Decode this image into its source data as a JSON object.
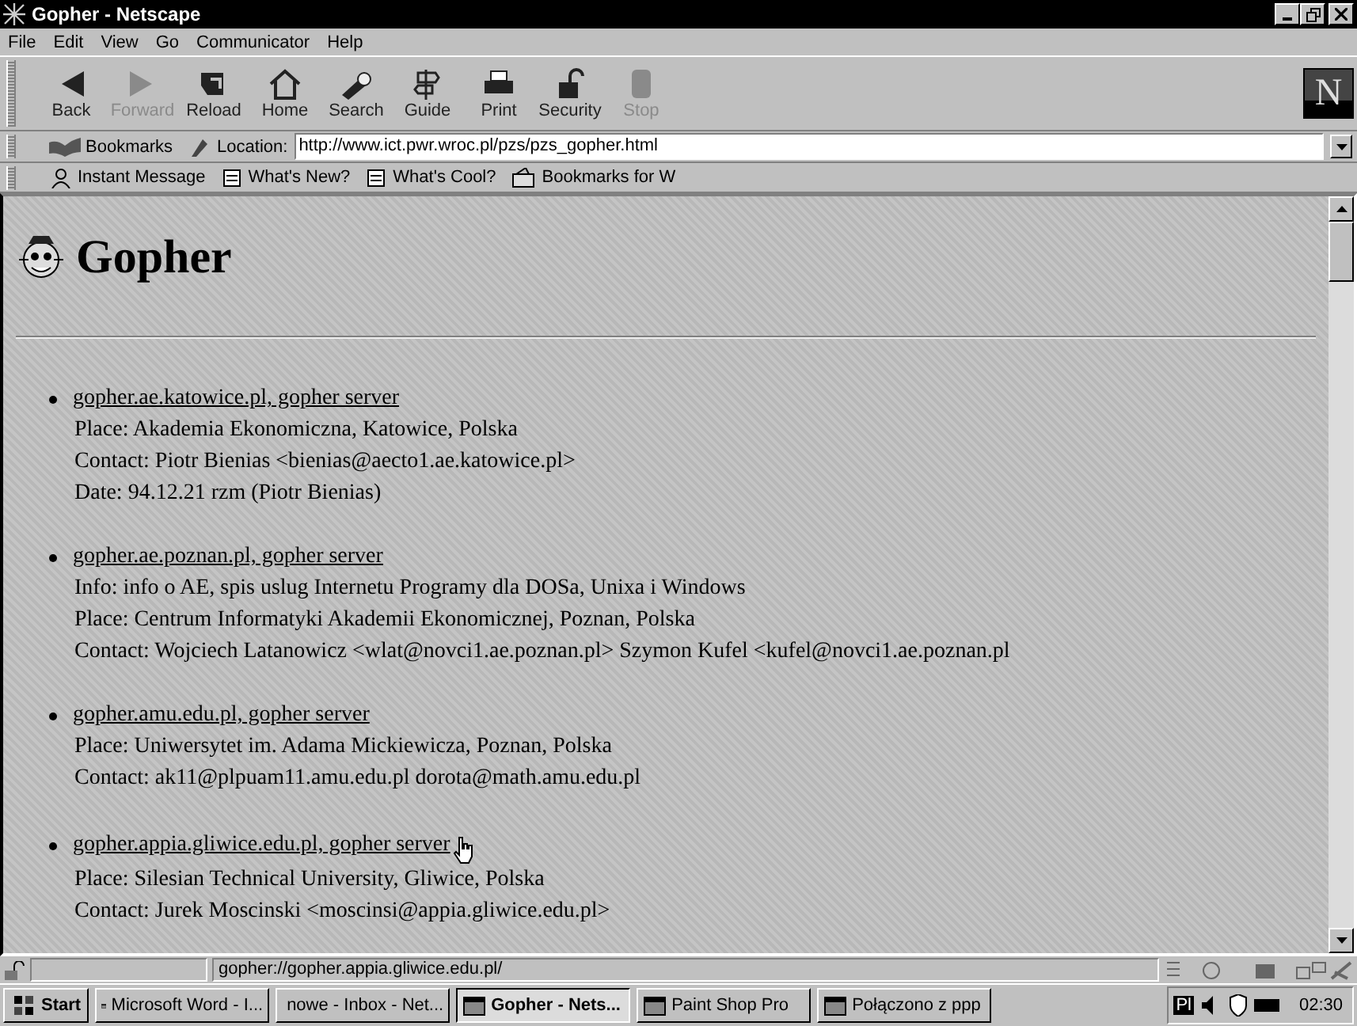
{
  "window": {
    "title": "Gopher - Netscape"
  },
  "menu": [
    "File",
    "Edit",
    "View",
    "Go",
    "Communicator",
    "Help"
  ],
  "toolbar": [
    {
      "label": "Back",
      "kind": "back",
      "disabled": false
    },
    {
      "label": "Forward",
      "kind": "forward",
      "disabled": true
    },
    {
      "label": "Reload",
      "kind": "reload",
      "disabled": false
    },
    {
      "label": "Home",
      "kind": "home",
      "disabled": false
    },
    {
      "label": "Search",
      "kind": "search",
      "disabled": false
    },
    {
      "label": "Guide",
      "kind": "guide",
      "disabled": false
    },
    {
      "label": "Print",
      "kind": "print",
      "disabled": false
    },
    {
      "label": "Security",
      "kind": "security",
      "disabled": false
    },
    {
      "label": "Stop",
      "kind": "stop",
      "disabled": true
    }
  ],
  "logo_letter": "N",
  "location_bar": {
    "bookmarks": "Bookmarks",
    "label": "Location:",
    "url": "http://www.ict.pwr.wroc.pl/pzs/pzs_gopher.html"
  },
  "personal_toolbar": [
    {
      "label": "Instant Message",
      "kind": "person"
    },
    {
      "label": "What's New?",
      "kind": "page"
    },
    {
      "label": "What's Cool?",
      "kind": "page"
    },
    {
      "label": "Bookmarks for W",
      "kind": "folder"
    }
  ],
  "page": {
    "heading": "Gopher",
    "entries": [
      {
        "link": "gopher.ae.katowice.pl, gopher server",
        "lines": [
          "Place: Akademia Ekonomiczna, Katowice, Polska",
          "Contact: Piotr Bienias <bienias@aecto1.ae.katowice.pl>",
          "Date: 94.12.21 rzm (Piotr Bienias)"
        ]
      },
      {
        "link": "gopher.ae.poznan.pl, gopher server",
        "lines": [
          "Info: info o AE, spis uslug Internetu Programy dla DOSa, Unixa i Windows",
          "Place: Centrum Informatyki Akademii Ekonomicznej, Poznan, Polska",
          "Contact: Wojciech Latanowicz <wlat@novci1.ae.poznan.pl> Szymon Kufel <kufel@novci1.ae.poznan.pl"
        ]
      },
      {
        "link": "gopher.amu.edu.pl, gopher server",
        "lines": [
          "Place: Uniwersytet im. Adama Mickiewicza, Poznan, Polska",
          "Contact: ak11@plpuam11.amu.edu.pl dorota@math.amu.edu.pl"
        ]
      },
      {
        "link": "gopher.appia.gliwice.edu.pl, gopher server",
        "lines": [
          "Place: Silesian Technical University, Gliwice, Polska",
          "Contact: Jurek Moscinski <moscinsi@appia.gliwice.edu.pl>"
        ]
      }
    ]
  },
  "status_bar": {
    "text": "gopher://gopher.appia.gliwice.edu.pl/"
  },
  "taskbar": {
    "start": "Start",
    "items": [
      {
        "label": "Microsoft Word - I...",
        "selected": false
      },
      {
        "label": "nowe - Inbox - Net...",
        "selected": false
      },
      {
        "label": "Gopher - Nets...",
        "selected": true
      },
      {
        "label": "Paint Shop Pro",
        "selected": false
      },
      {
        "label": "Połączono z ppp",
        "selected": false
      }
    ],
    "tray_lang": "Pl",
    "clock": "02:30"
  }
}
